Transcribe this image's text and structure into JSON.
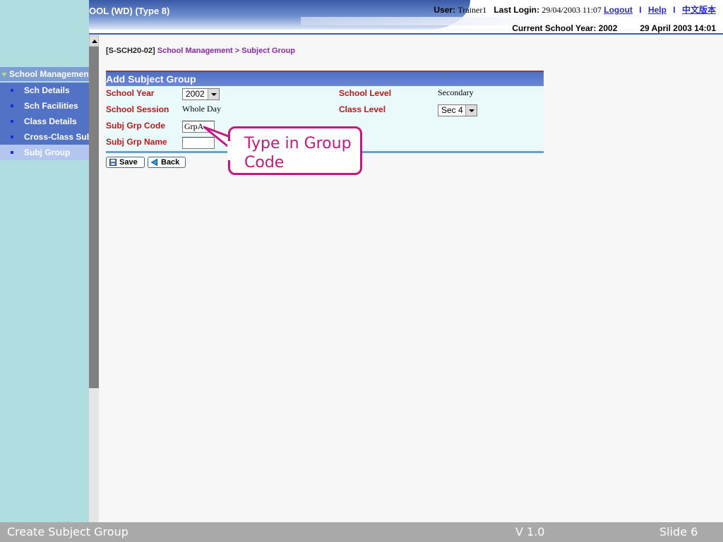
{
  "header": {
    "app_title": "OOL (WD) (Type 8)",
    "user_label": "User:",
    "user_name": "Trainer1",
    "last_login_label": "Last Login:",
    "last_login_value": "29/04/2003 11:07",
    "logout": "Logout",
    "sep": "I",
    "help": "Help",
    "chinese": "中文版本",
    "current_year": "Current School Year: 2002",
    "datetime": "29 April 2003 14:01"
  },
  "sidebar": {
    "heading": "School Management",
    "items": [
      {
        "label": "Sch Details"
      },
      {
        "label": "Sch Facilities"
      },
      {
        "label": "Class Details"
      },
      {
        "label": "Cross-Class Subj"
      },
      {
        "label": "Subj Group"
      }
    ],
    "active_index": 4
  },
  "breadcrumb": {
    "code": "[S-SCH20-02]",
    "path": "School Management > Subject Group"
  },
  "form": {
    "title": "Add Subject Group",
    "school_year_label": "School Year",
    "school_year_value": "2002",
    "school_level_label": "School Level",
    "school_level_value": "Secondary",
    "school_session_label": "School Session",
    "school_session_value": "Whole Day",
    "class_level_label": "Class Level",
    "class_level_value": "Sec 4",
    "subj_grp_code_label": "Subj Grp Code",
    "subj_grp_code_value": "GrpA",
    "subj_grp_name_label": "Subj Grp Name",
    "subj_grp_name_value": ""
  },
  "buttons": {
    "save": "Save",
    "back": "Back"
  },
  "callout": {
    "line1": "Type in Group",
    "line2": "Code",
    "color": "#c2187f"
  },
  "footer": {
    "title": "Create Subject Group",
    "version": "V 1.0",
    "slide": "Slide 6"
  }
}
